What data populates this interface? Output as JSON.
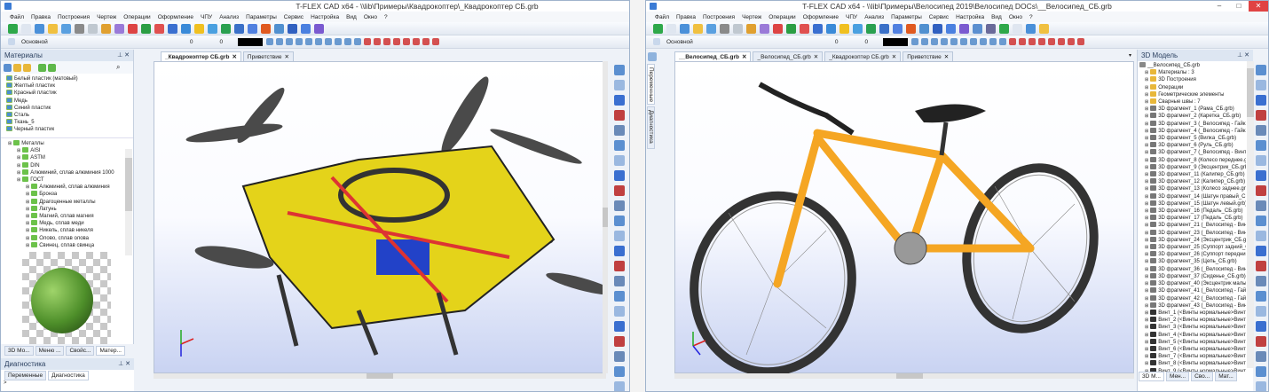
{
  "left_window": {
    "title": "T-FLEX CAD x64 - \\\\lib\\Примеры\\Квадрокоптер\\_Квадрокоптер СБ.grb",
    "menu": [
      "Файл",
      "Правка",
      "Построения",
      "Чертеж",
      "Операции",
      "Оформление",
      "ЧПУ",
      "Анализ",
      "Параметры",
      "Сервис",
      "Настройка",
      "Вид",
      "Окно",
      "?"
    ],
    "layer": "Основной",
    "level1": "0",
    "level2": "0",
    "materials_panel": {
      "title": "Материалы",
      "materials": [
        "Белый пластик (матовый)",
        "Желтый пластик",
        "Красный пластик",
        "Медь",
        "Синий пластик",
        "Сталь",
        "Ткань_5",
        "Черный пластик"
      ],
      "tree": [
        {
          "label": "Металлы",
          "level": 0
        },
        {
          "label": "AISI",
          "level": 1
        },
        {
          "label": "ASTM",
          "level": 1
        },
        {
          "label": "DIN",
          "level": 1
        },
        {
          "label": "Алюминий, сплав алюминия 1000",
          "level": 1
        },
        {
          "label": "ГОСТ",
          "level": 1
        },
        {
          "label": "Алюминий, сплав алюминия",
          "level": 2
        },
        {
          "label": "Бронза",
          "level": 2
        },
        {
          "label": "Драгоценные металлы",
          "level": 2
        },
        {
          "label": "Латунь",
          "level": 2
        },
        {
          "label": "Магний, сплав магния",
          "level": 2
        },
        {
          "label": "Медь, сплав меди",
          "level": 2
        },
        {
          "label": "Никель, сплав никеля",
          "level": 2
        },
        {
          "label": "Олово, сплав олова",
          "level": 2
        },
        {
          "label": "Свинец, сплав свинца",
          "level": 2
        }
      ]
    },
    "panel_tabs": [
      "3D Мо...",
      "Меню ...",
      "Свойс...",
      "Матер..."
    ],
    "doc_tabs": [
      "_Квадрокоптер СБ.grb",
      "Приветствие"
    ],
    "diagnostics": {
      "title": "Диагностика",
      "tabs": [
        "Переменные",
        "Диагностика"
      ],
      "prompt": ">"
    }
  },
  "right_window": {
    "title": "T-FLEX CAD x64 - \\\\lib\\Примеры\\Велосипед 2019\\Велосипед DOCs\\__Велосипед_СБ.grb",
    "menu": [
      "Файл",
      "Правка",
      "Построения",
      "Чертеж",
      "Операции",
      "Оформление",
      "ЧПУ",
      "Анализ",
      "Параметры",
      "Сервис",
      "Настройка",
      "Вид",
      "Окно",
      "?"
    ],
    "layer": "Основной",
    "level1": "0",
    "level2": "0",
    "side_tabs": [
      "Переменные",
      "Диагностика"
    ],
    "doc_tabs": [
      "__Велосипед_СБ.grb",
      "_Велосипед_СБ.grb",
      "_Квадрокоптер СБ.grb",
      "Приветствие"
    ],
    "model_panel": {
      "title": "3D Модель",
      "root": "__Велосипед_СБ.grb",
      "items": [
        "Материалы : 3",
        "3D Построения",
        "Операции",
        "Геометрические элементы",
        "Сварные швы : 7",
        "3D фрагмент_1 (Рама_СБ.grb)",
        "3D фрагмент_2 (Каретка_СБ.grb)",
        "3D фрагмент_3 (_Велосипед - Гайка ка",
        "3D фрагмент_4 (_Велосипед - Гайка ка",
        "3D фрагмент_5 (Вилка_СБ.grb)",
        "3D фрагмент_6 (Руль_СБ.grb)",
        "3D фрагмент_7 (_Велосипед - Винт.grb)",
        "3D фрагмент_8 (Колесо переднее.grb)",
        "3D фрагмент_9 (Эксцентрик_СБ.grb)",
        "3D фрагмент_11 (Калипер_СБ.grb)",
        "3D фрагмент_12 (Калипер_СБ.grb)",
        "3D фрагмент_13 (Колесо заднее.grb)",
        "3D фрагмент_14 (Шатун правый_СБ.grb)",
        "3D фрагмент_15 (Шатун левый.grb)",
        "3D фрагмент_16 (Педаль_СБ.grb)",
        "3D фрагмент_17 (Педаль_СБ.grb)",
        "3D фрагмент_21 (_Велосипед - Винт кр",
        "3D фрагмент_23 (_Велосипед - Винт кр",
        "3D фрагмент_24 (Эксцентрик_СБ.grb)",
        "3D фрагмент_25 (Суппорт задний_СБ.g",
        "3D фрагмент_26 (Суппорт передний_СБ",
        "3D фрагмент_35 (Цепь_СБ.grb)",
        "3D фрагмент_36 (_Велосипед - Винт М",
        "3D фрагмент_37 (Сиденье_СБ.grb)",
        "3D фрагмент_40 (Эксцентрик малый_С",
        "3D фрагмент_41 (_Велосипед - Гайка.g",
        "3D фрагмент_42 (_Велосипед - Гайка.g",
        "3D фрагмент_43 (_Велосипед - Винт М",
        "Винт_1 (<Винты нормальные>Винт ГОС",
        "Винт_2 (<Винты нормальные>Винт ГОС",
        "Винт_3 (<Винты нормальные>Винт ГОС",
        "Винт_4 (<Винты нормальные>Винт ГОС",
        "Винт_5 (<Винты нормальные>Винт ГОС",
        "Винт_6 (<Винты нормальные>Винт ГОС",
        "Винт_7 (<Винты нормальные>Винт ГОС",
        "Винт_8 (<Винты нормальные>Винт ГОС",
        "Винт_9 (<Винты нормальные>Винт ГОС"
      ]
    },
    "panel_tabs": [
      "3D М...",
      "Мен...",
      "Сво...",
      "Мат..."
    ]
  },
  "colors": {
    "accent": "#3a7bd5",
    "frame": "#f5a623",
    "close": "#e04343"
  }
}
